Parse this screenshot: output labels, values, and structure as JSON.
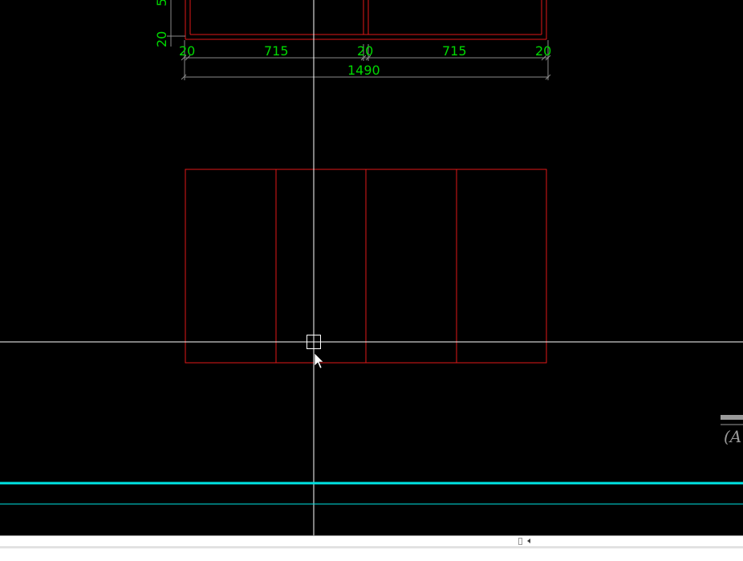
{
  "drawing": {
    "dim_20_left": "20",
    "dim_715_left": "715",
    "dim_20_mid": "20",
    "dim_715_right": "715",
    "dim_20_right": "20",
    "dim_total": "1490",
    "dim_vertical_20": "20",
    "dim_vertical_cut": "5",
    "annotation_partial": "(A"
  },
  "colors": {
    "background": "#000000",
    "frame": "#e01818",
    "dimension": "#00d800",
    "crosshair": "#ffffff",
    "cyan_line": "#00e5e5"
  },
  "command_line": {
    "value": "",
    "status": ""
  }
}
